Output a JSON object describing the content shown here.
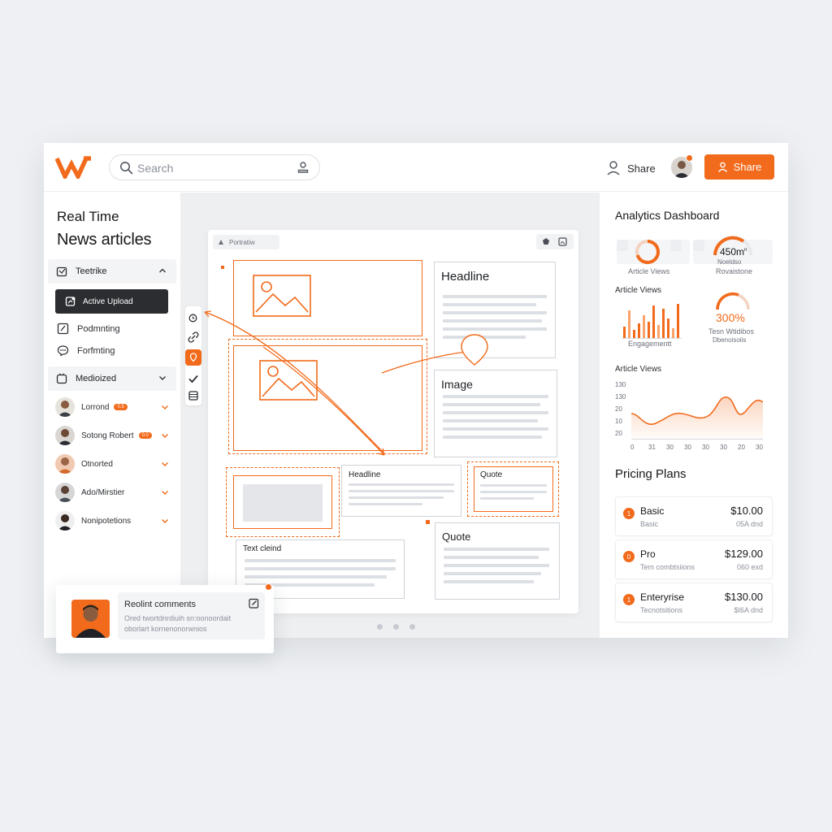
{
  "brand": {
    "accent": "#f26a1b",
    "dark": "#2b2d31"
  },
  "topbar": {
    "logo_icon": "w-logo-icon",
    "search_placeholder": "Search",
    "share_link": "Share",
    "share_button": "Share"
  },
  "left": {
    "title_line1": "Real Time",
    "title_line2": "News articles",
    "sections": [
      {
        "label": "Teetrike",
        "icon": "calendar-icon",
        "expanded": true
      },
      {
        "label": "Medioized",
        "icon": "grid-icon",
        "expanded": false
      }
    ],
    "active_upload": "Active Upload",
    "items": [
      {
        "label": "Podmnting",
        "icon": "pencil-icon"
      },
      {
        "label": "Forfmting",
        "icon": "chat-icon"
      }
    ],
    "people": [
      {
        "name": "Lorrond",
        "badge": "0.5"
      },
      {
        "name": "Sotong Robert",
        "badge": "0.0"
      },
      {
        "name": "Otnorted",
        "badge": ""
      },
      {
        "name": "Ado/Mirstier",
        "badge": ""
      },
      {
        "name": "Nonipotetions",
        "badge": ""
      }
    ]
  },
  "canvas": {
    "tab_label": "Portratiw",
    "cards": {
      "headline": "Headline",
      "image": "Image",
      "headline2": "Headline",
      "quote_small": "Quote",
      "quote": "Quote",
      "text": "Text cleind"
    },
    "pages": 3
  },
  "analytics": {
    "title": "Analytics Dashboard",
    "row1_caption": "Article Views",
    "stat1_value": "450m",
    "stat1_sup": "n",
    "stat1_caption1": "Noeldso",
    "stat1_caption2": "Rovaistone",
    "article_views_label": "Article Views",
    "bars_caption": "Engagementt",
    "stat2_value": "300%",
    "stat2_caption1": "Tesn Wtidibos",
    "stat2_caption2": "Dbenoisoiis",
    "line_title": "Article Views",
    "line_chart": {
      "type": "area",
      "ylabels": [
        "130",
        "130",
        "20",
        "10",
        "20"
      ],
      "xlabels": [
        "0",
        "31",
        "30",
        "30",
        "30",
        "30",
        "20",
        "30"
      ]
    }
  },
  "pricing": {
    "title": "Pricing Plans",
    "plans": [
      {
        "name": "Basic",
        "sub": "Basic",
        "price": "$10.00",
        "price_sub": "05A dnd",
        "num": "1"
      },
      {
        "name": "Pro",
        "sub": "Tem combtsiions",
        "price": "$129.00",
        "price_sub": "060 exd",
        "num": "0"
      },
      {
        "name": "Enteryrise",
        "sub": "Tecnotsitions",
        "price": "$130.00",
        "price_sub": "$I6A dnd",
        "num": "1"
      }
    ]
  },
  "comments": {
    "title": "Reolint comments",
    "desc": "Ored twortdnrdiuih sn:oonoordait oborlart kornenonorwnios"
  }
}
